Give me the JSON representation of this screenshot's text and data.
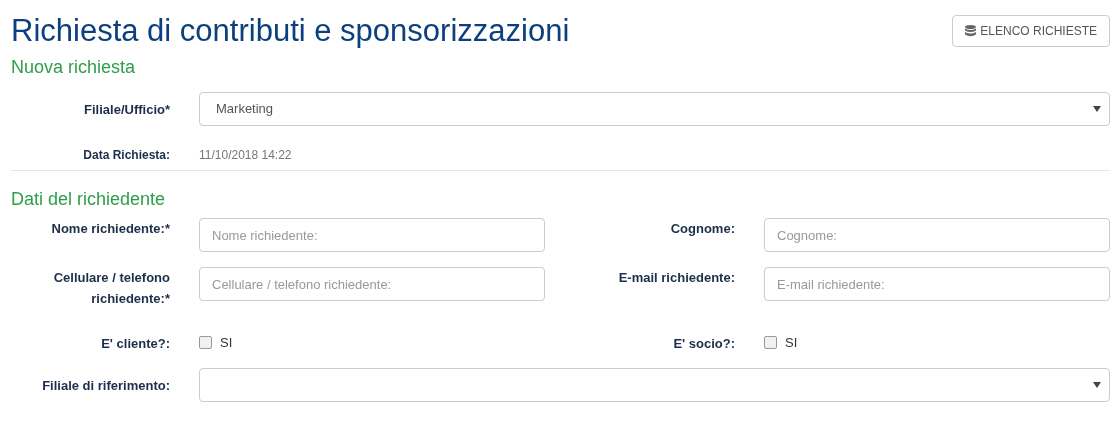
{
  "title": "Richiesta di contributi e sponsorizzazioni",
  "list_button": {
    "label": "ELENCO RICHIESTE"
  },
  "new_request": {
    "heading": "Nuova richiesta",
    "office": {
      "label": "Filiale/Ufficio*",
      "value": "Marketing"
    },
    "date": {
      "label": "Data Richiesta:",
      "value": "11/10/2018 14:22"
    }
  },
  "applicant": {
    "heading": "Dati del richiedente",
    "rows": [
      {
        "left": {
          "kind": "text",
          "label": "Nome richiedente:*",
          "placeholder": "Nome richiedente:"
        },
        "right": {
          "kind": "text",
          "label": "Cognome:",
          "placeholder": "Cognome:"
        }
      },
      {
        "left": {
          "kind": "text",
          "label": "Cellulare / telefono richiedente:*",
          "placeholder": "Cellulare / telefono richiedente:"
        },
        "right": {
          "kind": "text",
          "label": "E-mail richiedente:",
          "placeholder": "E-mail richiedente:"
        }
      },
      {
        "left": {
          "kind": "checkbox",
          "label": "E' cliente?:",
          "option": "SI",
          "checked": false
        },
        "right": {
          "kind": "checkbox",
          "label": "E' socio?:",
          "option": "SI",
          "checked": false
        }
      }
    ],
    "branch": {
      "label": "Filiale di riferimento:"
    }
  }
}
